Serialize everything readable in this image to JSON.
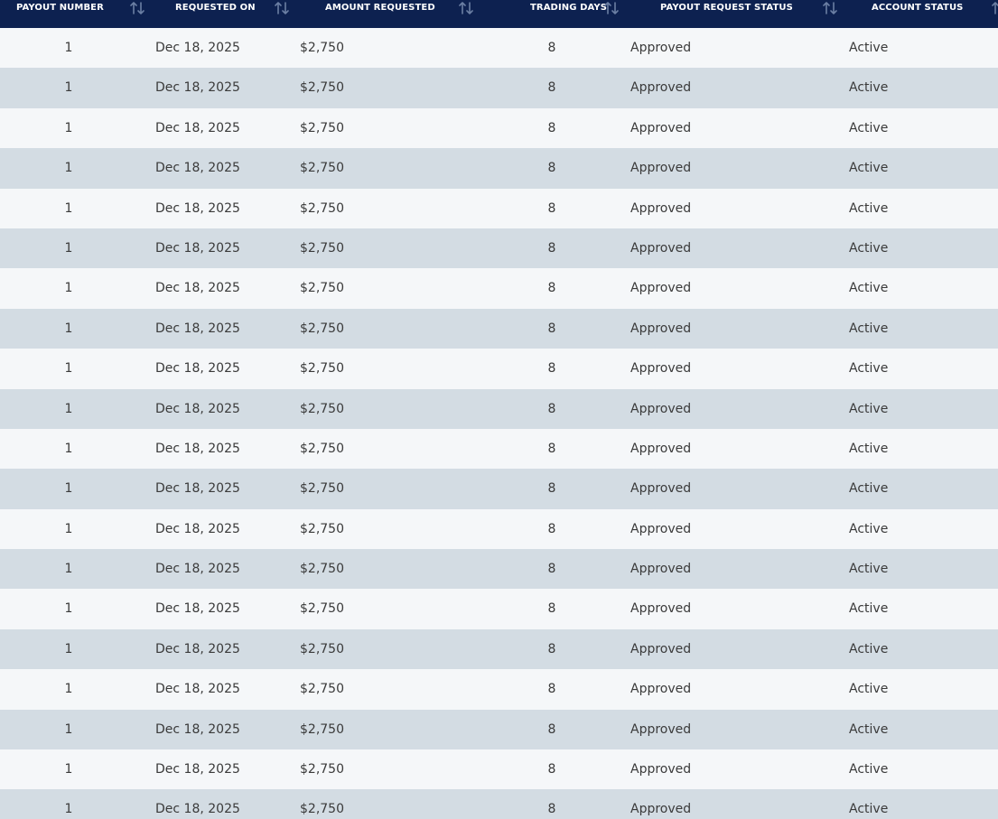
{
  "columns": [
    {
      "key": "payout_number",
      "label": "PAYOUT NUMBER"
    },
    {
      "key": "requested_on",
      "label": "REQUESTED ON"
    },
    {
      "key": "amount_requested",
      "label": "AMOUNT REQUESTED"
    },
    {
      "key": "trading_days",
      "label": "TRADING DAYS"
    },
    {
      "key": "payout_request_status",
      "label": "PAYOUT REQUEST STATUS"
    },
    {
      "key": "account_status",
      "label": "ACCOUNT STATUS"
    }
  ],
  "icons": {
    "sort": "sort-arrows-icon"
  },
  "colors": {
    "header_bg": "#0d2150",
    "header_text": "#ffffff",
    "sort_icon": "#6b7fa3",
    "row_light": "#f5f7f9",
    "row_dark": "#d3dce3",
    "cell_text": "#3a3a3a"
  },
  "rows": [
    {
      "payout_number": "1",
      "requested_on": "Dec 18, 2025",
      "amount_requested": "$2,750",
      "trading_days": "8",
      "payout_request_status": "Approved",
      "account_status": "Active"
    },
    {
      "payout_number": "1",
      "requested_on": "Dec 18, 2025",
      "amount_requested": "$2,750",
      "trading_days": "8",
      "payout_request_status": "Approved",
      "account_status": "Active"
    },
    {
      "payout_number": "1",
      "requested_on": "Dec 18, 2025",
      "amount_requested": "$2,750",
      "trading_days": "8",
      "payout_request_status": "Approved",
      "account_status": "Active"
    },
    {
      "payout_number": "1",
      "requested_on": "Dec 18, 2025",
      "amount_requested": "$2,750",
      "trading_days": "8",
      "payout_request_status": "Approved",
      "account_status": "Active"
    },
    {
      "payout_number": "1",
      "requested_on": "Dec 18, 2025",
      "amount_requested": "$2,750",
      "trading_days": "8",
      "payout_request_status": "Approved",
      "account_status": "Active"
    },
    {
      "payout_number": "1",
      "requested_on": "Dec 18, 2025",
      "amount_requested": "$2,750",
      "trading_days": "8",
      "payout_request_status": "Approved",
      "account_status": "Active"
    },
    {
      "payout_number": "1",
      "requested_on": "Dec 18, 2025",
      "amount_requested": "$2,750",
      "trading_days": "8",
      "payout_request_status": "Approved",
      "account_status": "Active"
    },
    {
      "payout_number": "1",
      "requested_on": "Dec 18, 2025",
      "amount_requested": "$2,750",
      "trading_days": "8",
      "payout_request_status": "Approved",
      "account_status": "Active"
    },
    {
      "payout_number": "1",
      "requested_on": "Dec 18, 2025",
      "amount_requested": "$2,750",
      "trading_days": "8",
      "payout_request_status": "Approved",
      "account_status": "Active"
    },
    {
      "payout_number": "1",
      "requested_on": "Dec 18, 2025",
      "amount_requested": "$2,750",
      "trading_days": "8",
      "payout_request_status": "Approved",
      "account_status": "Active"
    },
    {
      "payout_number": "1",
      "requested_on": "Dec 18, 2025",
      "amount_requested": "$2,750",
      "trading_days": "8",
      "payout_request_status": "Approved",
      "account_status": "Active"
    },
    {
      "payout_number": "1",
      "requested_on": "Dec 18, 2025",
      "amount_requested": "$2,750",
      "trading_days": "8",
      "payout_request_status": "Approved",
      "account_status": "Active"
    },
    {
      "payout_number": "1",
      "requested_on": "Dec 18, 2025",
      "amount_requested": "$2,750",
      "trading_days": "8",
      "payout_request_status": "Approved",
      "account_status": "Active"
    },
    {
      "payout_number": "1",
      "requested_on": "Dec 18, 2025",
      "amount_requested": "$2,750",
      "trading_days": "8",
      "payout_request_status": "Approved",
      "account_status": "Active"
    },
    {
      "payout_number": "1",
      "requested_on": "Dec 18, 2025",
      "amount_requested": "$2,750",
      "trading_days": "8",
      "payout_request_status": "Approved",
      "account_status": "Active"
    },
    {
      "payout_number": "1",
      "requested_on": "Dec 18, 2025",
      "amount_requested": "$2,750",
      "trading_days": "8",
      "payout_request_status": "Approved",
      "account_status": "Active"
    },
    {
      "payout_number": "1",
      "requested_on": "Dec 18, 2025",
      "amount_requested": "$2,750",
      "trading_days": "8",
      "payout_request_status": "Approved",
      "account_status": "Active"
    },
    {
      "payout_number": "1",
      "requested_on": "Dec 18, 2025",
      "amount_requested": "$2,750",
      "trading_days": "8",
      "payout_request_status": "Approved",
      "account_status": "Active"
    },
    {
      "payout_number": "1",
      "requested_on": "Dec 18, 2025",
      "amount_requested": "$2,750",
      "trading_days": "8",
      "payout_request_status": "Approved",
      "account_status": "Active"
    },
    {
      "payout_number": "1",
      "requested_on": "Dec 18, 2025",
      "amount_requested": "$2,750",
      "trading_days": "8",
      "payout_request_status": "Approved",
      "account_status": "Active"
    }
  ]
}
